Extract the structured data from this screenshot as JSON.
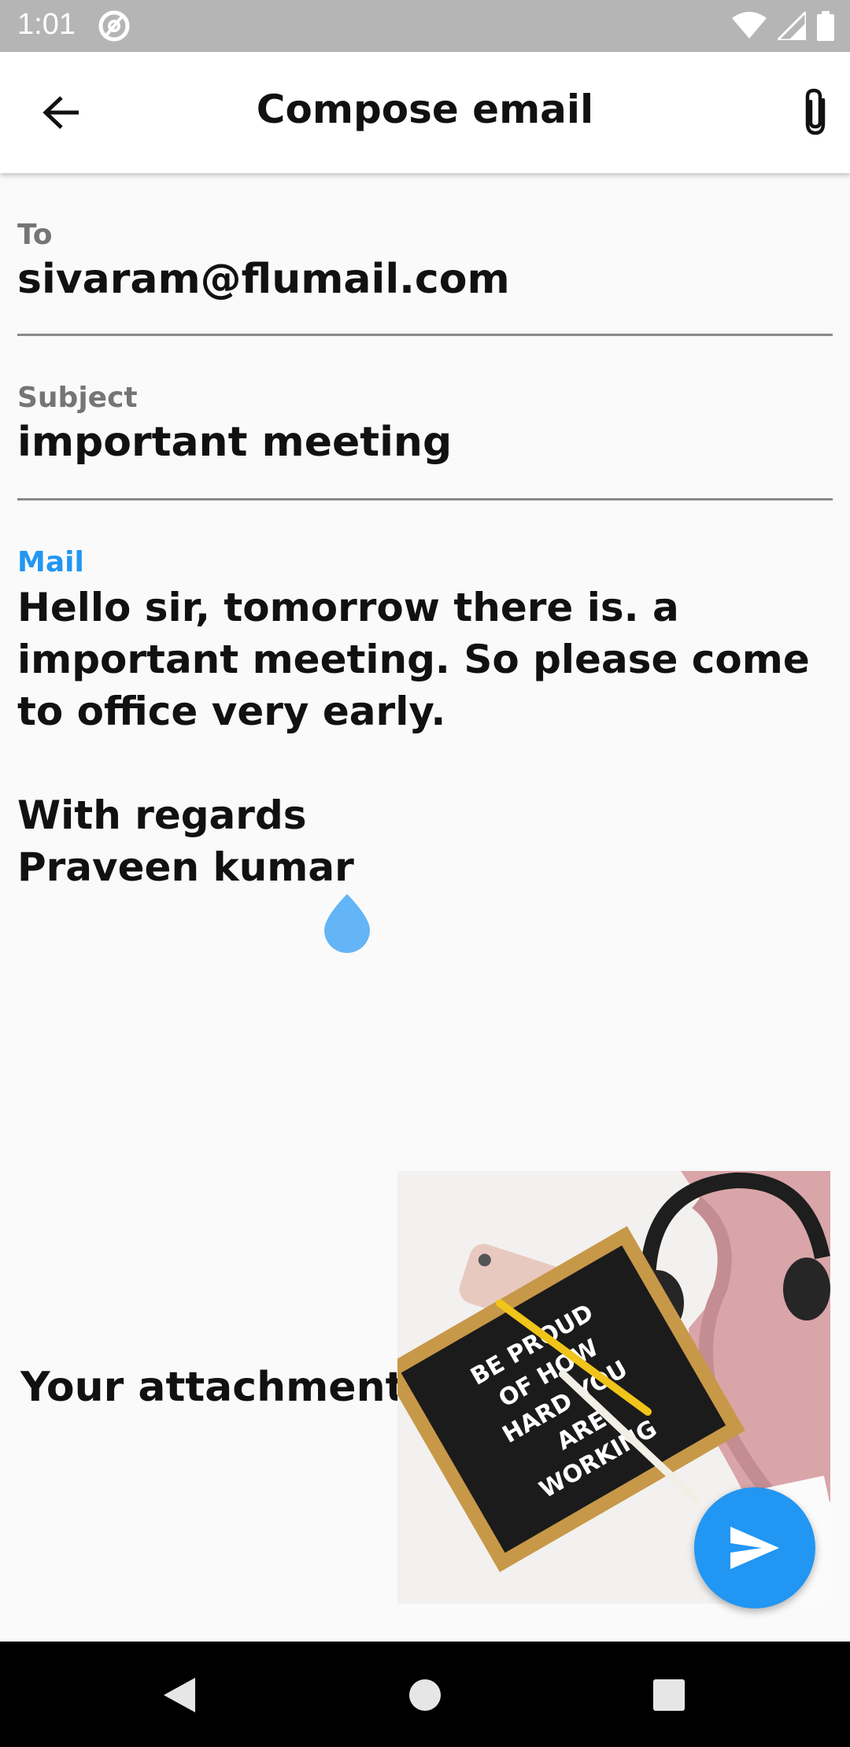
{
  "status_bar": {
    "time": "1:01",
    "icons": [
      "at-sign-icon",
      "wifi-icon",
      "signal-icon",
      "battery-icon"
    ]
  },
  "app_bar": {
    "title": "Compose email",
    "back_icon": "back-arrow-icon",
    "attach_icon": "paperclip-icon"
  },
  "form": {
    "to_label": "To",
    "to_value": "sivaram@flumail.com",
    "subject_label": "Subject",
    "subject_value": "important meeting",
    "mail_label": "Mail",
    "mail_body": "Hello sir, tomorrow there is. a\nimportant meeting. So please come\nto office very early.\n\nWith regards\nPraveen kumar"
  },
  "attachment": {
    "label": "Your attachment",
    "image_text": "BE PROUD\nOF HOW\nHARD YOU\nARE\nWORKING"
  },
  "fab": {
    "icon": "send-icon"
  },
  "nav_bar": {
    "icons": [
      "nav-back-icon",
      "nav-home-icon",
      "nav-recents-icon"
    ]
  },
  "colors": {
    "accent": "#2196f3",
    "status_bar": "#b5b5b5",
    "label_gray": "#757575",
    "text": "#111111"
  }
}
